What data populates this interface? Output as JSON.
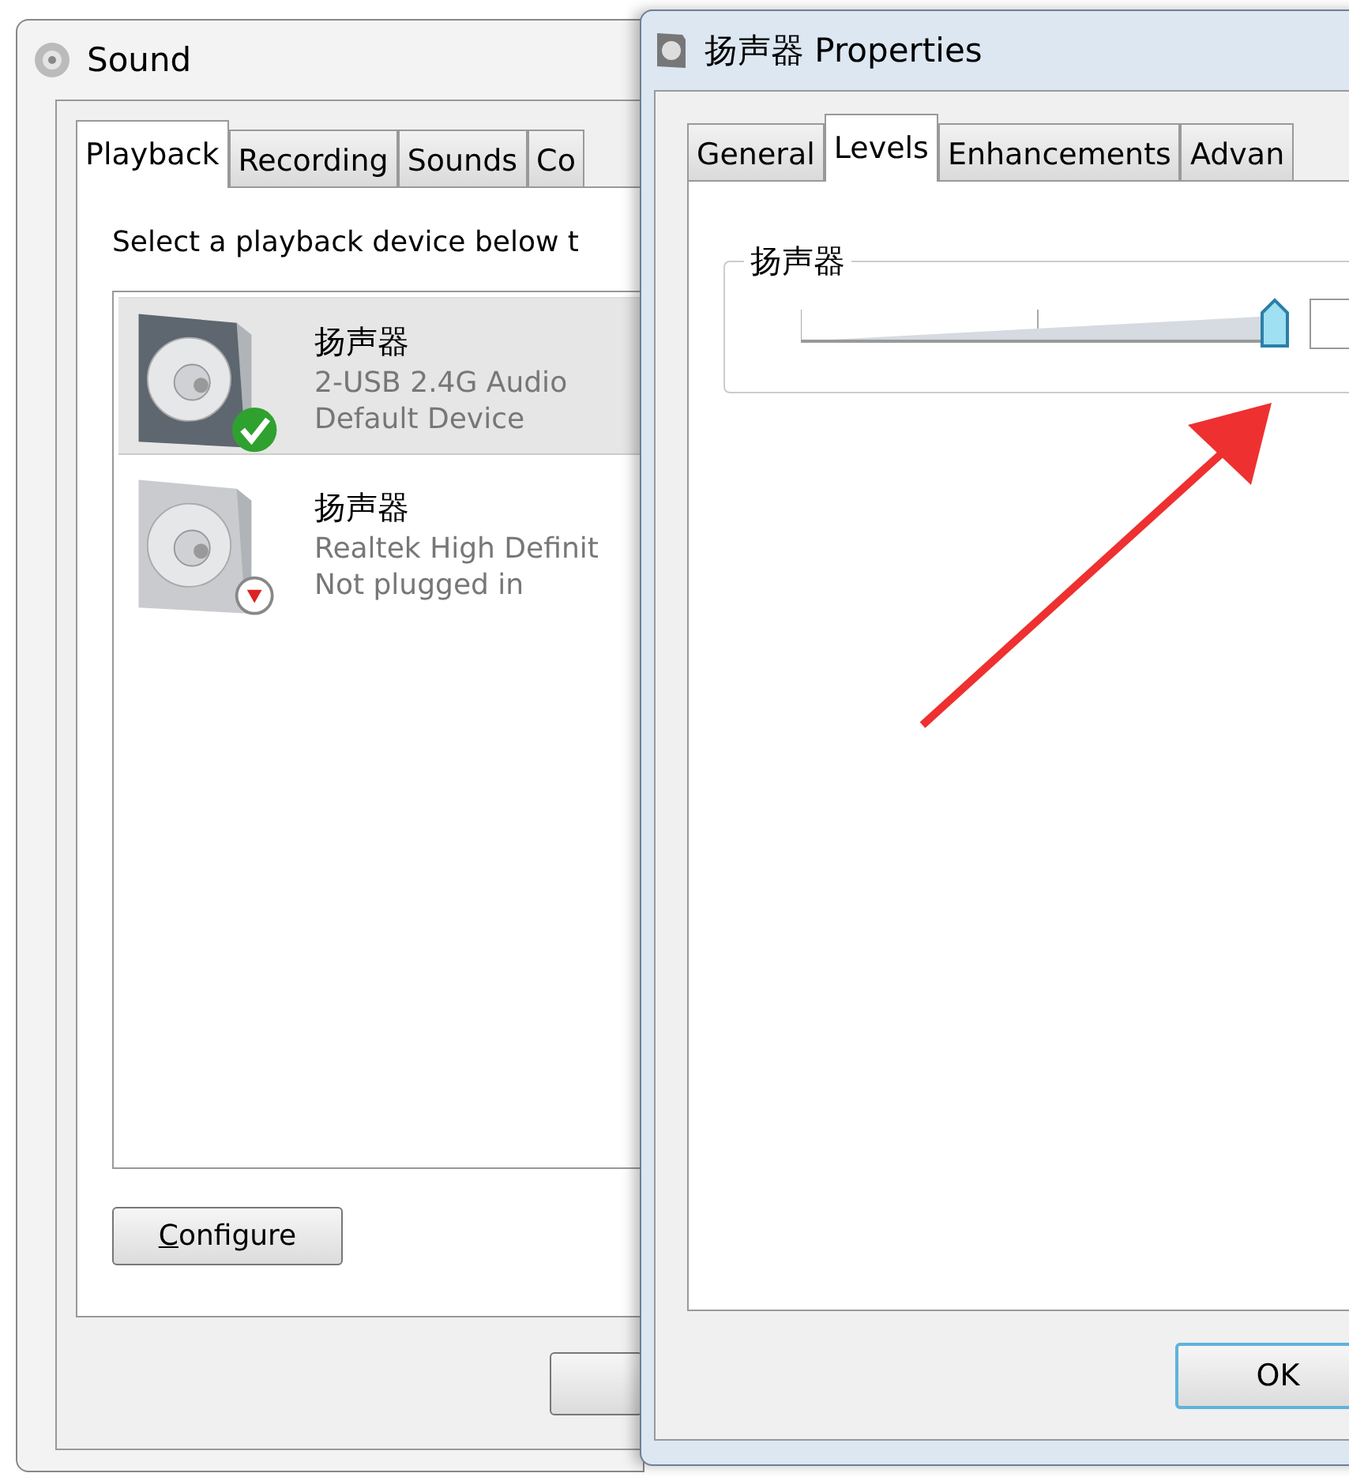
{
  "sound_window": {
    "title": "Sound",
    "tabs": [
      {
        "label": "Playback",
        "selected": true
      },
      {
        "label": "Recording",
        "selected": false
      },
      {
        "label": "Sounds",
        "selected": false
      },
      {
        "label": "Co",
        "selected": false
      }
    ],
    "instruction": "Select a playback device below t",
    "devices": [
      {
        "name": "扬声器",
        "description": "2-USB 2.4G Audio",
        "status": "Default Device",
        "kind": "default",
        "selected": true
      },
      {
        "name": "扬声器",
        "description": "Realtek High Definit",
        "status": "Not plugged in",
        "kind": "unplugged",
        "selected": false
      }
    ],
    "configure_button": "Configure"
  },
  "properties_window": {
    "title": "扬声器 Properties",
    "tabs": [
      {
        "label": "General",
        "selected": false
      },
      {
        "label": "Levels",
        "selected": true
      },
      {
        "label": "Enhancements",
        "selected": false
      },
      {
        "label": "Advan",
        "selected": false
      }
    ],
    "level_group": {
      "label": "扬声器",
      "level": 1
    },
    "ok_button": "OK"
  }
}
